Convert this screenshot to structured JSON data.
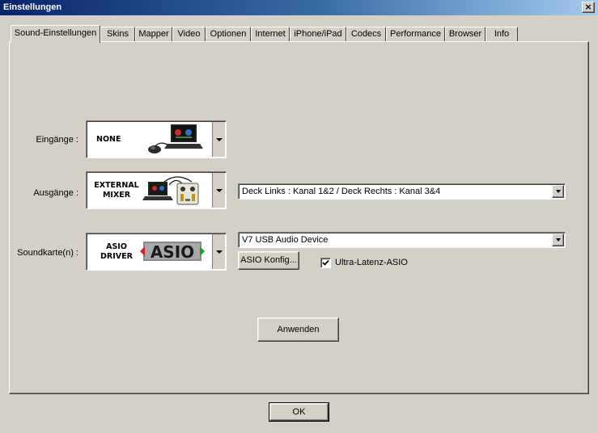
{
  "window": {
    "title": "Einstellungen",
    "close_glyph": "×"
  },
  "tabs": [
    {
      "label": "Sound-Einstellungen",
      "active": true
    },
    {
      "label": "Skins"
    },
    {
      "label": "Mapper"
    },
    {
      "label": "Video"
    },
    {
      "label": "Optionen"
    },
    {
      "label": "Internet"
    },
    {
      "label": "iPhone/iPad"
    },
    {
      "label": "Codecs"
    },
    {
      "label": "Performance"
    },
    {
      "label": "Browser"
    },
    {
      "label": "Info"
    }
  ],
  "inputs": {
    "label": "Eingänge :",
    "caption": "NONE",
    "icon": "laptop-turntable-icon"
  },
  "outputs": {
    "label": "Ausgänge :",
    "caption_line1": "EXTERNAL",
    "caption_line2": "MIXER",
    "icon": "laptop-mixer-icon",
    "routing_value": "Deck Links : Kanal 1&2 / Deck Rechts : Kanal 3&4"
  },
  "soundcard": {
    "label": "Soundkarte(n) :",
    "caption_line1": "ASIO",
    "caption_line2": "DRIVER",
    "logo_text": "ASIO",
    "icon": "asio-logo-icon",
    "device_value": "V7 USB Audio Device",
    "config_button": "ASIO Konfig...",
    "ultra_latency_label": "Ultra-Latenz-ASIO",
    "ultra_latency_checked": true
  },
  "apply_button": "Anwenden",
  "ok_button": "OK"
}
